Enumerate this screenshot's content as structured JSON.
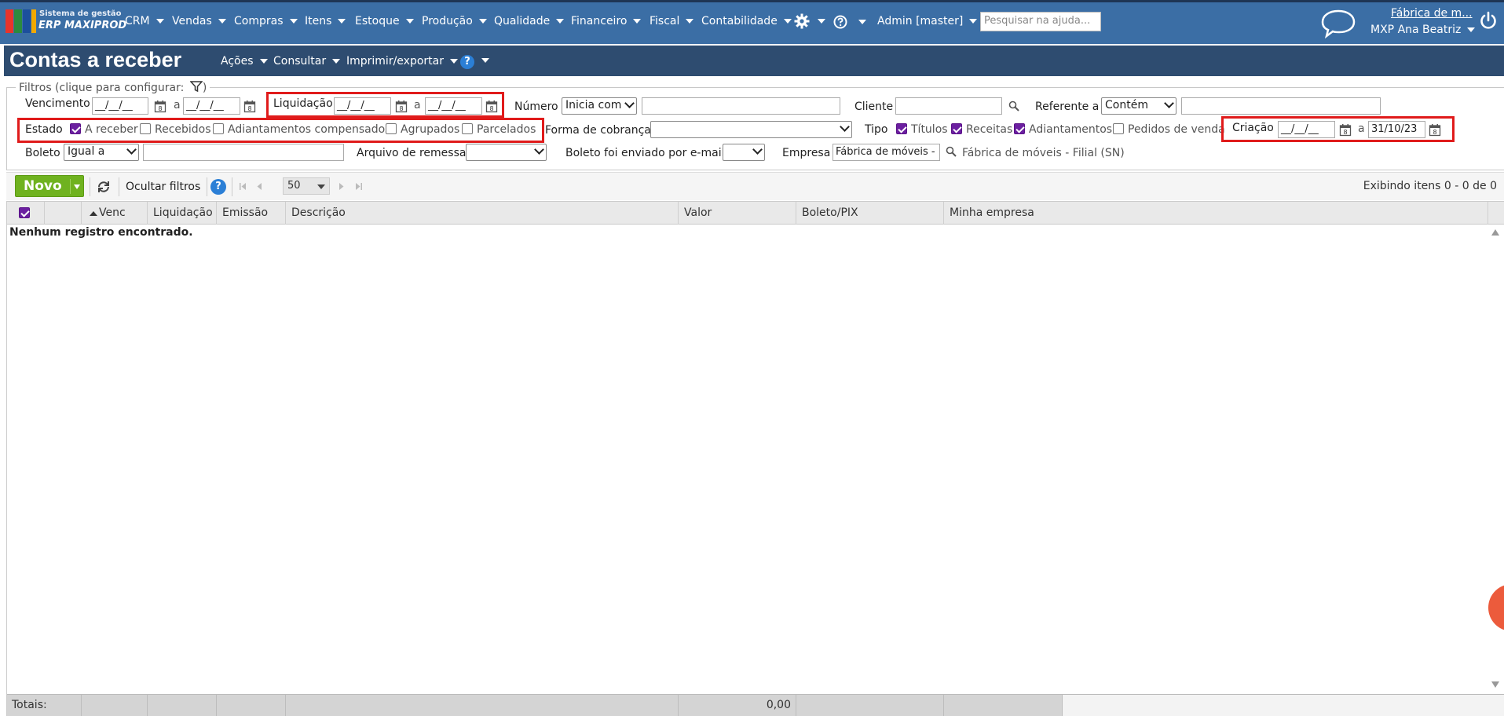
{
  "app": {
    "logo_line1": "Sistema de gestão",
    "logo_line2": "ERP MAXIPROD",
    "nav": [
      "CRM",
      "Vendas",
      "Compras",
      "Itens",
      "Estoque",
      "Produção",
      "Qualidade",
      "Financeiro",
      "Fiscal",
      "Contabilidade"
    ],
    "user_menu": "Admin [master]",
    "help_search_placeholder": "Pesquisar na ajuda...",
    "company": "Fábrica de m...",
    "user": "MXP Ana Beatriz"
  },
  "page": {
    "title": "Contas a receber",
    "menus": [
      "Ações",
      "Consultar",
      "Imprimir/exportar"
    ]
  },
  "filters": {
    "legend": "Filtros (clique para configurar:",
    "legend_close": ")",
    "vencimento": {
      "label": "Vencimento",
      "from": "__/__/__",
      "sep": "a",
      "to": "__/__/__"
    },
    "liquidacao": {
      "label": "Liquidação",
      "from": "__/__/__",
      "sep": "a",
      "to": "__/__/__"
    },
    "numero": {
      "label": "Número",
      "mode": "Inicia com",
      "value": ""
    },
    "cliente": {
      "label": "Cliente",
      "value": ""
    },
    "referente": {
      "label": "Referente a",
      "mode": "Contém",
      "value": ""
    },
    "estado": {
      "label": "Estado",
      "options": [
        {
          "label": "A receber",
          "checked": true
        },
        {
          "label": "Recebidos",
          "checked": false
        },
        {
          "label": "Adiantamentos compensados",
          "checked": false
        },
        {
          "label": "Agrupados",
          "checked": false
        },
        {
          "label": "Parcelados",
          "checked": false
        }
      ]
    },
    "forma_cobranca": {
      "label": "Forma de cobrança",
      "value": ""
    },
    "tipo": {
      "label": "Tipo",
      "options": [
        {
          "label": "Títulos",
          "checked": true
        },
        {
          "label": "Receitas",
          "checked": true
        },
        {
          "label": "Adiantamentos",
          "checked": true
        },
        {
          "label": "Pedidos de venda",
          "checked": false
        }
      ]
    },
    "criacao": {
      "label": "Criação",
      "from": "__/__/__",
      "sep": "a",
      "to": "31/10/23"
    },
    "boleto": {
      "label": "Boleto",
      "mode": "Igual a",
      "value": ""
    },
    "arquivo_remessa": {
      "label": "Arquivo de remessa",
      "value": ""
    },
    "boleto_email": {
      "label": "Boleto foi enviado por e-mail",
      "value": ""
    },
    "empresa": {
      "label": "Empresa",
      "value": "Fábrica de móveis -",
      "resolved": "Fábrica de móveis - Filial (SN)"
    }
  },
  "toolbar": {
    "new_label": "Novo",
    "hide_filters": "Ocultar filtros",
    "page_size": "50",
    "showing": "Exibindo itens 0 - 0 de 0"
  },
  "grid": {
    "columns": [
      "",
      "",
      "Venc",
      "Liquidação",
      "Emissão",
      "Descrição",
      "Valor",
      "Boleto/PIX",
      "Minha empresa"
    ],
    "empty_message": "Nenhum registro encontrado.",
    "totals_label": "Totais:",
    "totals_value": "0,00"
  },
  "colors": {
    "nav_bg": "#3b6ea5",
    "header_bg": "#2e4c70",
    "novo_green": "#6fb21f",
    "checkbox_purple": "#6b1fa0",
    "highlight_red": "#e01b1b"
  }
}
